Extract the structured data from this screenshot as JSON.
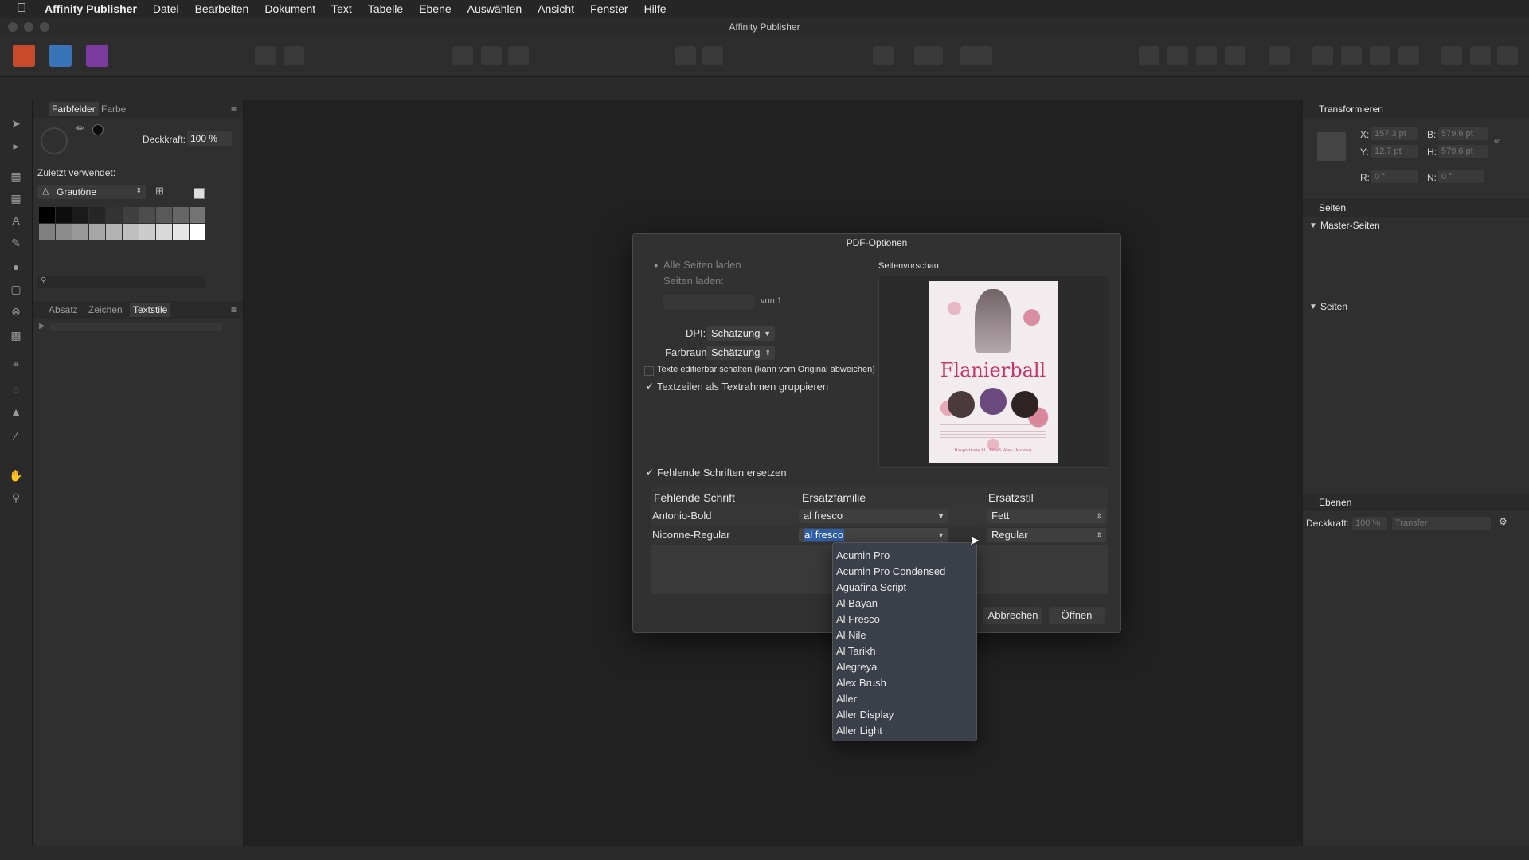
{
  "menubar": {
    "app": "Affinity Publisher",
    "items": [
      "Datei",
      "Bearbeiten",
      "Dokument",
      "Text",
      "Tabelle",
      "Ebene",
      "Auswählen",
      "Ansicht",
      "Fenster",
      "Hilfe"
    ]
  },
  "window": {
    "title": "Affinity Publisher"
  },
  "left_panel": {
    "tabs_top": [
      "Farbfelder",
      "Farbe"
    ],
    "opacity_label": "Deckkraft:",
    "opacity_value": "100 %",
    "recent_label": "Zuletzt verwendet:",
    "palette_name": "Grautöne",
    "tabs_bottom": [
      "Absatz",
      "Zeichen",
      "Textstile"
    ]
  },
  "right_panel": {
    "transform_title": "Transformieren",
    "x_label": "X:",
    "x_value": "157,3 pt",
    "y_label": "Y:",
    "y_value": "12,7 pt",
    "b_label": "B:",
    "b_value": "579,6 pt",
    "h_label": "H:",
    "h_value": "579,6 pt",
    "r_label": "R:",
    "r_value": "0 °",
    "n_label": "N:",
    "n_value": "0 °",
    "pages_title": "Seiten",
    "master_pages": "Master-Seiten",
    "pages": "Seiten",
    "layers_title": "Ebenen",
    "layers_opacity_label": "Deckkraft:",
    "layers_opacity_value": "100 %",
    "blend_mode": "Transfer"
  },
  "dialog": {
    "title": "PDF-Optionen",
    "all_pages": "Alle Seiten laden",
    "load_pages": "Seiten laden:",
    "of_label": "von 1",
    "preview_label": "Seitenvorschau:",
    "dpi_label": "DPI:",
    "dpi_value": "Schätzung",
    "colorspace_label": "Farbraum:",
    "colorspace_value": "Schätzung",
    "editable_text": "Texte editierbar schalten (kann vom Original abweichen)",
    "group_lines": "Textzeilen als Textrahmen gruppieren",
    "replace_fonts": "Fehlende Schriften ersetzen",
    "table": {
      "headers": [
        "Fehlende Schrift",
        "Ersatzfamilie",
        "Ersatzstil"
      ],
      "rows": [
        {
          "font": "Antonio-Bold",
          "family": "al fresco",
          "style": "Fett"
        },
        {
          "font": "Niconne-Regular",
          "family": "al fresco",
          "style": "Regular"
        }
      ]
    },
    "cancel": "Abbrechen",
    "open": "Öffnen",
    "poster_title": "Flanierball",
    "poster_footer": "Hauptstraße 11, 12345 Wien (Muster)"
  },
  "dropdown": {
    "options": [
      "Acumin Pro",
      "Acumin Pro Condensed",
      "Aguafina Script",
      "Al Bayan",
      "Al Fresco",
      "Al Nile",
      "Al Tarikh",
      "Alegreya",
      "Alex Brush",
      "Aller",
      "Aller Display",
      "Aller Light"
    ]
  },
  "colors": {
    "selection": "#2f5fa8",
    "dropdown_bg": "#3b3f49",
    "poster_accent": "#c2366b"
  }
}
